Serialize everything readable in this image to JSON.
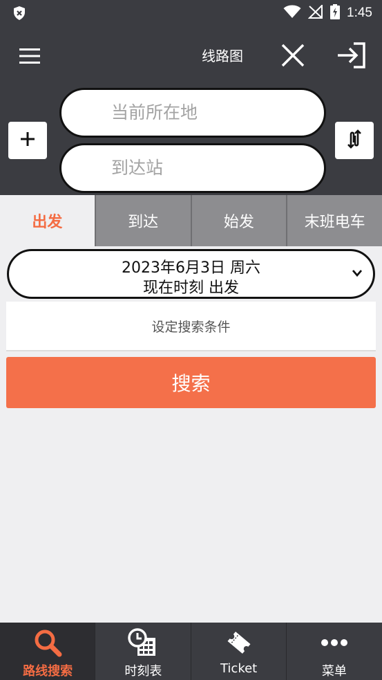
{
  "status_bar": {
    "time": "1:45",
    "icons": [
      "shield-icon",
      "wifi-icon",
      "signal-off-icon",
      "battery-charging-icon"
    ]
  },
  "app_bar": {
    "route_map_label": "线路图",
    "icons": [
      "menu-icon",
      "close-icon",
      "login-icon"
    ]
  },
  "search": {
    "from_placeholder": "当前所在地",
    "to_placeholder": "到达站",
    "add_icon": "plus-icon",
    "swap_icon": "swap-vertical-icon"
  },
  "tabs": [
    {
      "label": "出发",
      "active": true
    },
    {
      "label": "到达",
      "active": false
    },
    {
      "label": "始发",
      "active": false
    },
    {
      "label": "末班电车",
      "active": false
    }
  ],
  "date_selector": {
    "line1": "2023年6月3日 周六",
    "line2": "现在时刻 出发"
  },
  "condition_button": "设定搜索条件",
  "search_button": "搜索",
  "bottom_nav": [
    {
      "label": "路线搜索",
      "icon": "search-icon",
      "active": true
    },
    {
      "label": "时刻表",
      "icon": "timetable-icon",
      "active": false
    },
    {
      "label": "Ticket",
      "icon": "ticket-icon",
      "active": false
    },
    {
      "label": "菜单",
      "icon": "more-icon",
      "active": false
    }
  ],
  "colors": {
    "accent": "#f46c43",
    "dark_bar": "#3b3c41",
    "inactive_tab": "#8d8d90",
    "background": "#efeff1",
    "search_button": "#f4704a"
  }
}
